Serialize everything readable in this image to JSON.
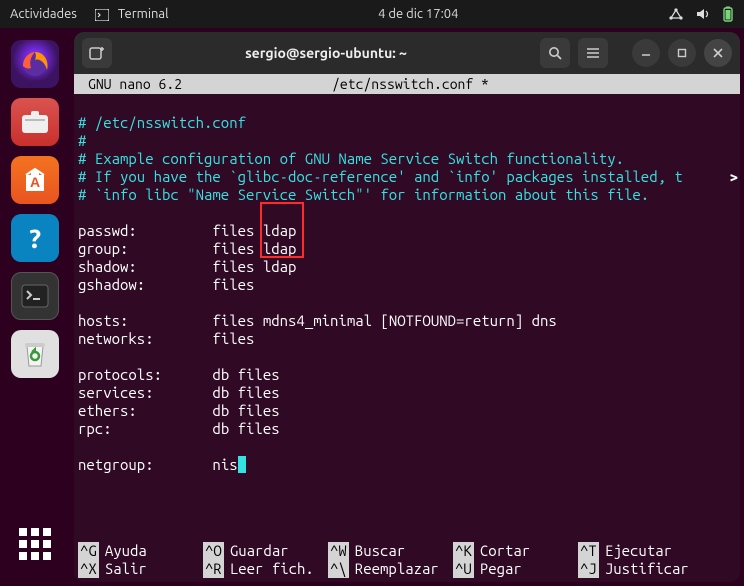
{
  "topbar": {
    "activities": "Actividades",
    "app_label": "Terminal",
    "datetime": "4 de dic  17:04"
  },
  "window": {
    "title": "sergio@sergio-ubuntu: ~"
  },
  "nano": {
    "version": "GNU nano 6.2",
    "filename": "/etc/nsswitch.conf *"
  },
  "file": {
    "c0": "# /etc/nsswitch.conf",
    "c1": "#",
    "c2": "# Example configuration of GNU Name Service Switch functionality.",
    "c3": "# If you have the `glibc-doc-reference' and `info' packages installed, t",
    "c4": "# `info libc \"Name Service Switch\"' for information about this file.",
    "rows": {
      "passwd": {
        "k": "passwd:",
        "v": "files ldap"
      },
      "group": {
        "k": "group:",
        "v": "files ldap"
      },
      "shadow": {
        "k": "shadow:",
        "v": "files ldap"
      },
      "gshadow": {
        "k": "gshadow:",
        "v": "files"
      },
      "hosts": {
        "k": "hosts:",
        "v": "files mdns4_minimal [NOTFOUND=return] dns"
      },
      "networks": {
        "k": "networks:",
        "v": "files"
      },
      "protocols": {
        "k": "protocols:",
        "v": "db files"
      },
      "services": {
        "k": "services:",
        "v": "db files"
      },
      "ethers": {
        "k": "ethers:",
        "v": "db files"
      },
      "rpc": {
        "k": "rpc:",
        "v": "db files"
      },
      "netgroup": {
        "k": "netgroup:",
        "v": "nis"
      }
    }
  },
  "shortcuts": {
    "r1": [
      {
        "key": "^G",
        "label": "Ayuda"
      },
      {
        "key": "^O",
        "label": "Guardar"
      },
      {
        "key": "^W",
        "label": "Buscar"
      },
      {
        "key": "^K",
        "label": "Cortar"
      },
      {
        "key": "^T",
        "label": "Ejecutar"
      }
    ],
    "r2": [
      {
        "key": "^X",
        "label": "Salir"
      },
      {
        "key": "^R",
        "label": "Leer fich."
      },
      {
        "key": "^\\",
        "label": "Reemplazar"
      },
      {
        "key": "^U",
        "label": "Pegar"
      },
      {
        "key": "^J",
        "label": "Justificar"
      }
    ]
  },
  "dock": {
    "items": [
      "firefox",
      "files",
      "software",
      "help",
      "terminal",
      "trash",
      "apps"
    ]
  }
}
